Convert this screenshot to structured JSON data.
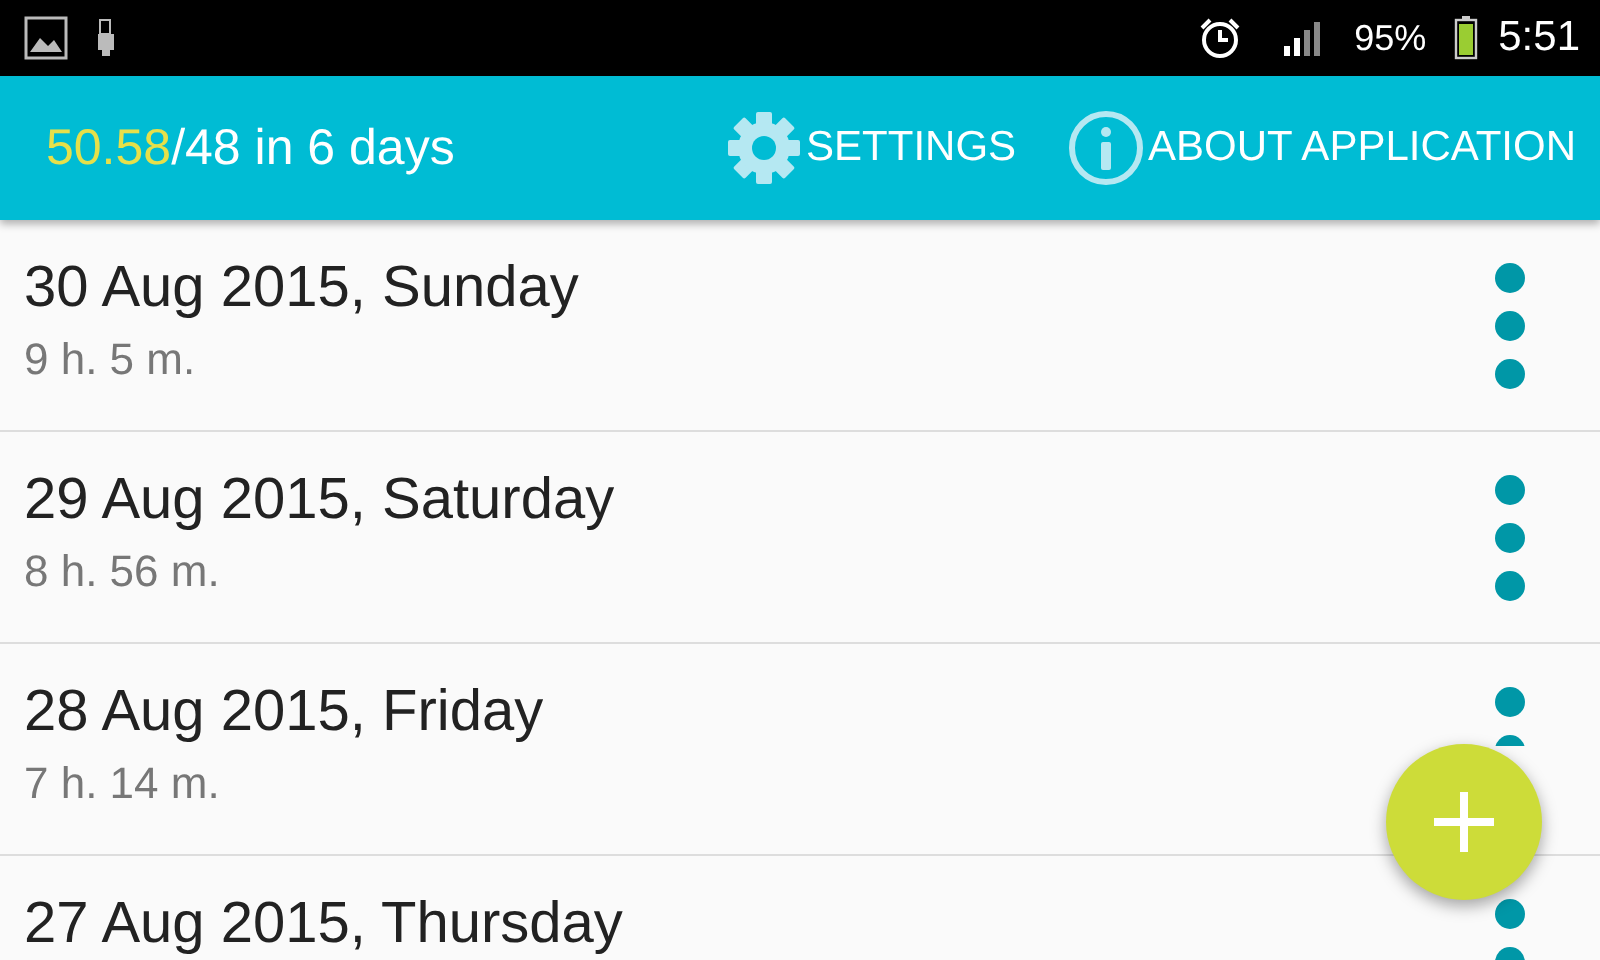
{
  "status_bar": {
    "battery": "95%",
    "time": "5:51"
  },
  "toolbar": {
    "progress": "50.58",
    "goal": "/48 in 6 days",
    "actions": [
      {
        "kind": "settings",
        "label": "SETTINGS"
      },
      {
        "kind": "about",
        "label": "ABOUT APPLICATION"
      }
    ]
  },
  "days": [
    {
      "date": "30 Aug 2015, Sunday",
      "duration": "9 h. 5 m."
    },
    {
      "date": "29 Aug 2015, Saturday",
      "duration": "8 h. 56 m."
    },
    {
      "date": "28 Aug 2015, Friday",
      "duration": "7 h. 14 m."
    },
    {
      "date": "27 Aug 2015, Thursday"
    }
  ]
}
